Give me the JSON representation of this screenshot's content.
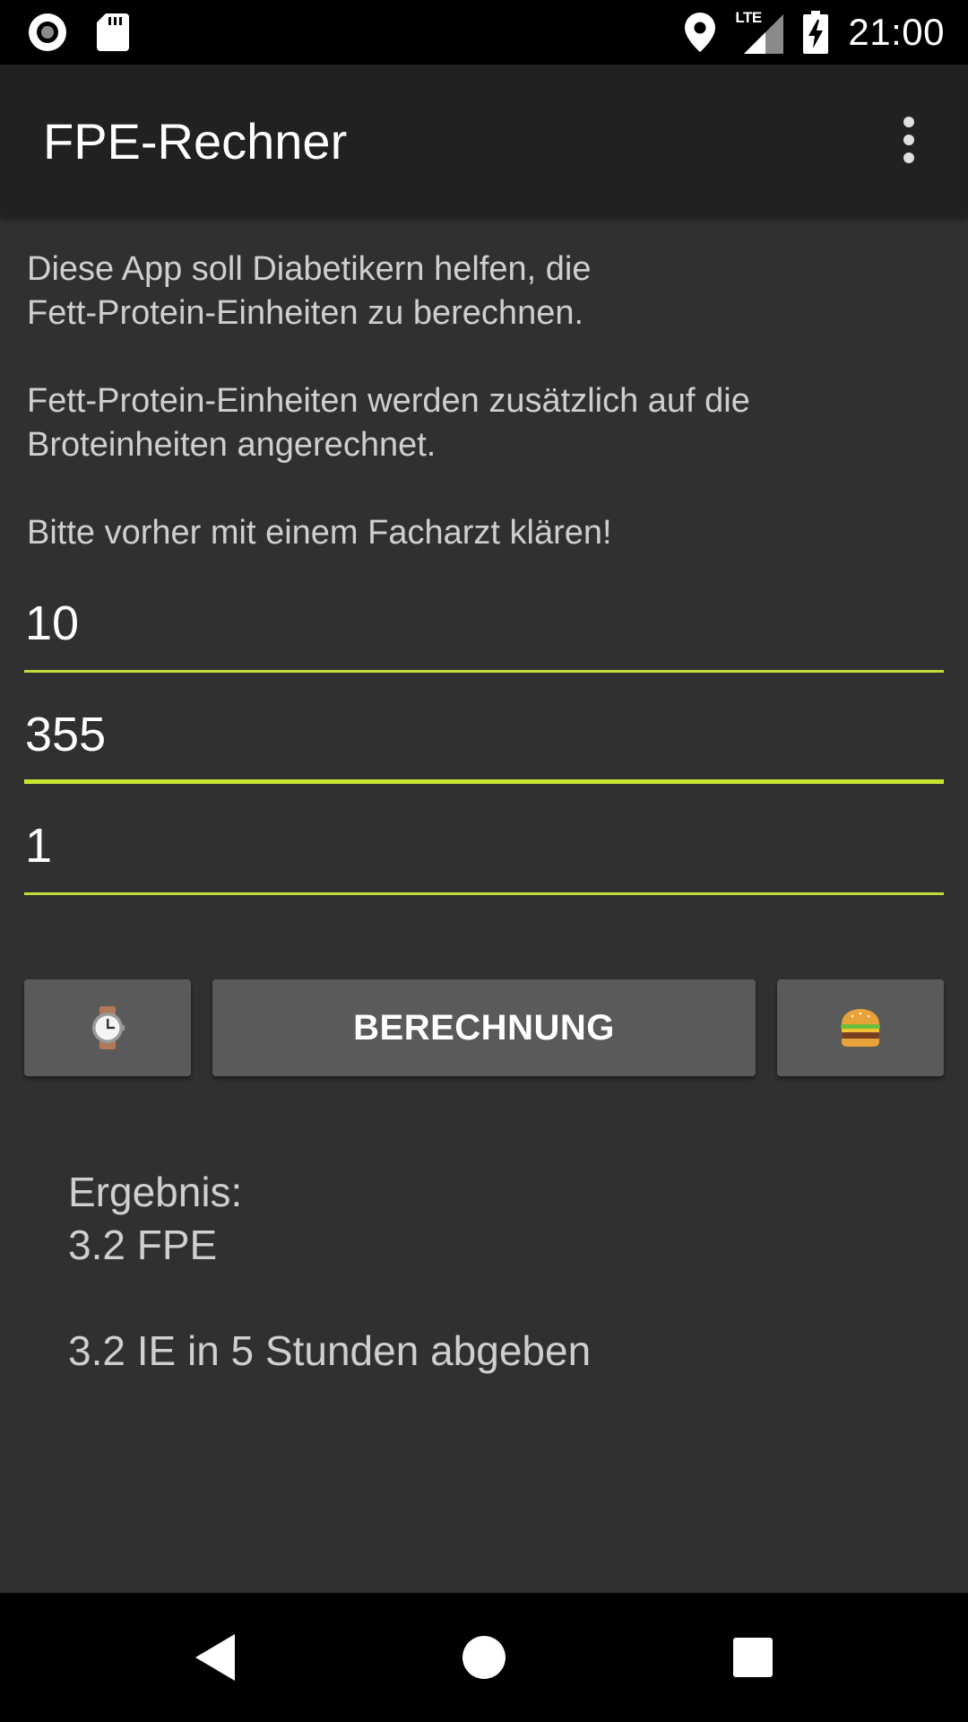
{
  "status_bar": {
    "time": "21:00",
    "network": "LTE"
  },
  "app_bar": {
    "title": "FPE-Rechner"
  },
  "intro": {
    "line1": "Diese App soll Diabetikern helfen, die",
    "line2": "Fett-Protein-Einheiten zu berechnen.",
    "line3": "Fett-Protein-Einheiten werden zusätzlich auf die",
    "line4": "Broteinheiten angerechnet.",
    "line5": "Bitte vorher mit einem Facharzt klären!"
  },
  "inputs": {
    "field1_value": "10",
    "field2_value": "355",
    "field3_value": "1"
  },
  "buttons": {
    "calculate_label": "BERECHNUNG",
    "left_icon": "watch-icon",
    "right_icon": "hamburger-icon"
  },
  "result": {
    "label": "Ergebnis:",
    "fpe": "3.2 FPE",
    "instruction": "3.2 IE in 5 Stunden abgeben"
  },
  "colors": {
    "accent": "#c0dd3a",
    "background": "#303030",
    "app_bar": "#212121",
    "button": "#5a5a5a"
  }
}
